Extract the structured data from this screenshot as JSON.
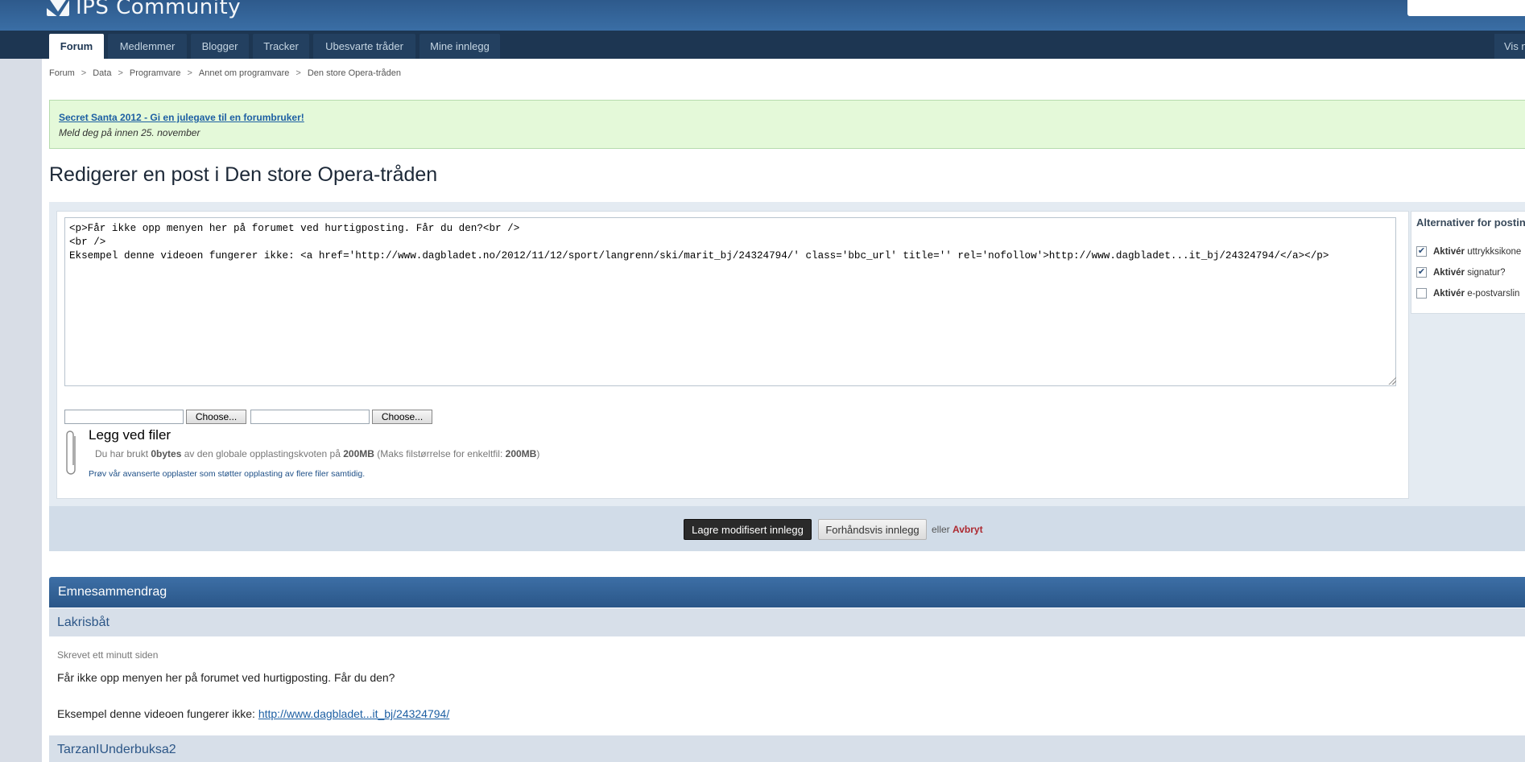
{
  "header": {
    "logo_text": "IPS Community",
    "search_placeholder": ""
  },
  "nav": {
    "tabs": [
      {
        "label": "Forum",
        "active": true
      },
      {
        "label": "Medlemmer",
        "active": false
      },
      {
        "label": "Blogger",
        "active": false
      },
      {
        "label": "Tracker",
        "active": false
      },
      {
        "label": "Ubesvarte tråder",
        "active": false
      },
      {
        "label": "Mine innlegg",
        "active": false
      }
    ],
    "right_label": "Vis n"
  },
  "breadcrumb": {
    "items": [
      "Forum",
      "Data",
      "Programvare",
      "Annet om programvare",
      "Den store Opera-tråden"
    ],
    "separator": ">"
  },
  "notice": {
    "link": "Secret Santa 2012 - Gi en julegave til en forumbruker!",
    "subtitle": "Meld deg på innen 25. november"
  },
  "page_title": "Redigerer en post i Den store Opera-tråden",
  "editor": {
    "content": "<p>Får ikke opp menyen her på forumet ved hurtigposting. Får du den?<br />\n<br />\nEksempel denne videoen fungerer ikke: <a href='http://www.dagbladet.no/2012/11/12/sport/langrenn/ski/marit_bj/24324794/' class='bbc_url' title='' rel='nofollow'>http://www.dagbladet...it_bj/24324794/</a></p>"
  },
  "attachments": {
    "choose_label_1": "Choose...",
    "choose_label_2": "Choose...",
    "title": "Legg ved filer",
    "quota_prefix": "Du har brukt",
    "quota_used": "0bytes",
    "quota_mid": "av den globale opplastingskvoten på",
    "quota_total": "200MB",
    "quota_max_prefix": "(Maks filstørrelse for enkeltfil:",
    "quota_max": "200MB",
    "quota_suffix": ")",
    "advanced_link": "Prøv vår avanserte opplaster som støtter opplasting av flere filer samtidig."
  },
  "options": {
    "title": "Alternativer for postin",
    "items": [
      {
        "bold": "Aktivér",
        "label": "uttrykksikone",
        "checked": true
      },
      {
        "bold": "Aktivér",
        "label": "signatur?",
        "checked": true
      },
      {
        "bold": "Aktivér",
        "label": "e-postvarslin",
        "checked": false
      }
    ]
  },
  "actions": {
    "save": "Lagre modifisert innlegg",
    "preview": "Forhåndsvis innlegg",
    "or": "eller",
    "cancel": "Avbryt"
  },
  "summary": {
    "header": "Emnesammendrag",
    "posts": [
      {
        "author": "Lakrisbåt",
        "time": "Skrevet ett minutt siden",
        "line1": "Får ikke opp menyen her på forumet ved hurtigposting. Får du den?",
        "line2_prefix": "Eksempel denne videoen fungerer ikke: ",
        "line2_link": "http://www.dagbladet...it_bj/24324794/"
      },
      {
        "author": "TarzanIUnderbuksa2"
      }
    ]
  },
  "colors": {
    "header_blue": "#2e5a8c",
    "nav_dark": "#1d3652",
    "notice_green": "#e4f9d9",
    "cancel_red": "#ad2930"
  }
}
